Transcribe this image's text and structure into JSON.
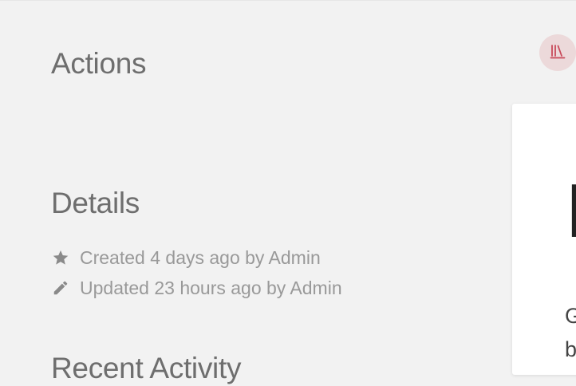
{
  "sidebar": {
    "actions_heading": "Actions",
    "details_heading": "Details",
    "details": [
      {
        "icon": "star-icon",
        "text": "Created 4 days ago by Admin"
      },
      {
        "icon": "pencil-icon",
        "text": "Updated 23 hours ago by Admin"
      }
    ],
    "activity_heading": "Recent Activity"
  },
  "header": {
    "shelves_button_icon": "bookshelf-icon",
    "shelves_button_color": "#c84a5a"
  },
  "content": {
    "title_fragment": "I",
    "text_lines": [
      "G",
      "b"
    ]
  },
  "colors": {
    "background": "#f2f2f2",
    "card": "#ffffff",
    "heading": "#6e6e6e",
    "meta_text": "#999999",
    "accent": "#c84a5a",
    "accent_bg": "#ecd9da"
  }
}
